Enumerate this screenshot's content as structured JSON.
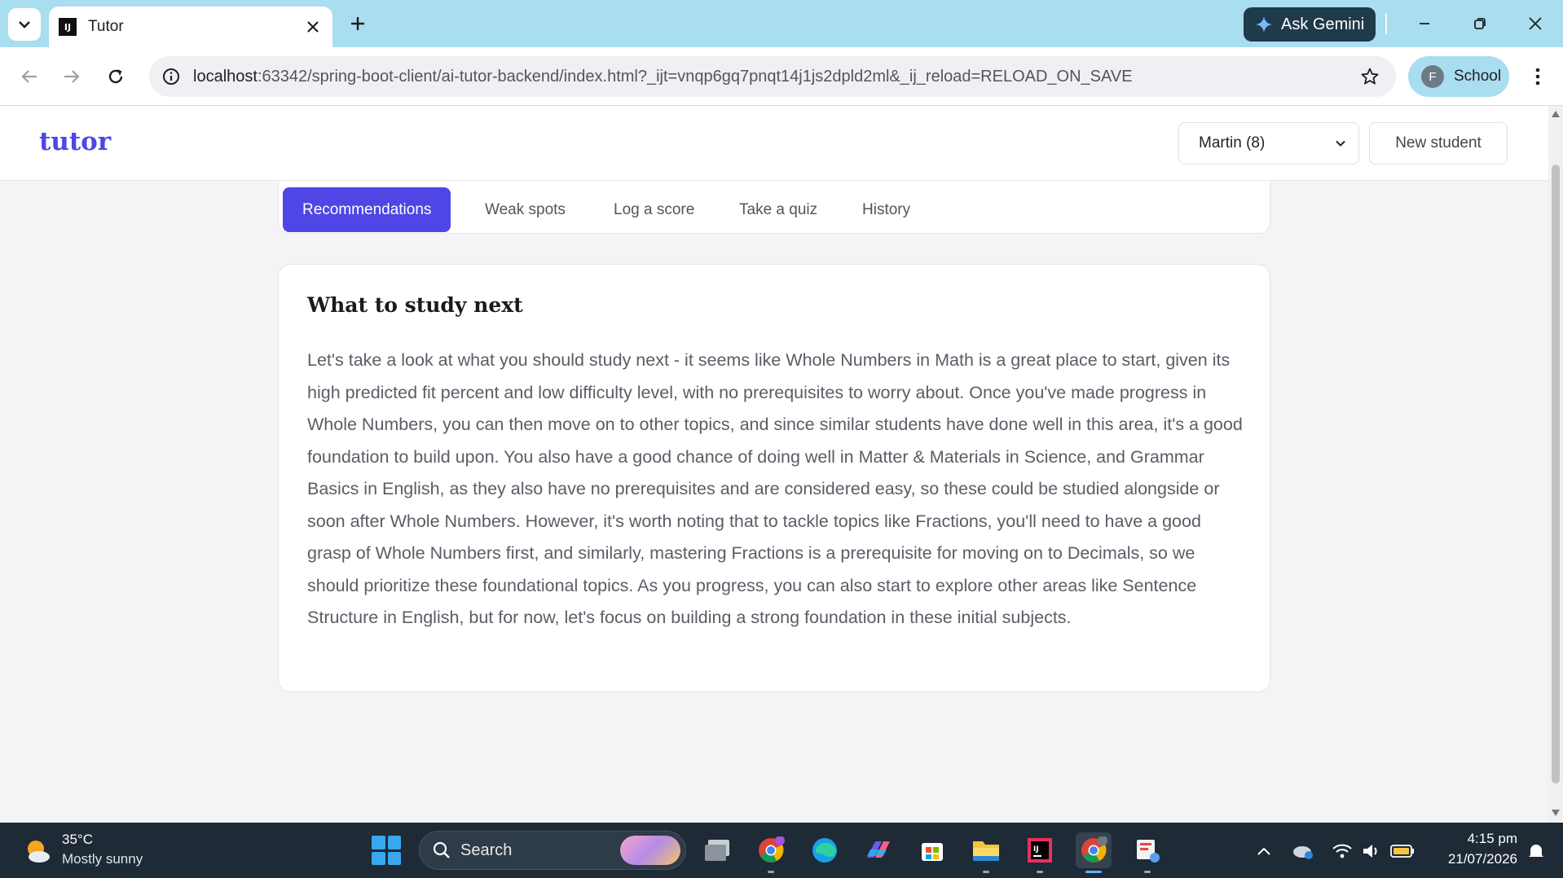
{
  "browser": {
    "tab_title": "Tutor",
    "favicon_text": "IJ",
    "gemini_label": "Ask Gemini",
    "url_host": "localhost",
    "url_rest": ":63342/spring-boot-client/ai-tutor-backend/index.html?_ijt=vnqp6gq7pnqt14j1js2dpld2ml&_ij_reload=RELOAD_ON_SAVE",
    "profile_initial": "F",
    "profile_name": "School"
  },
  "app": {
    "brand": "tutor",
    "student_selected": "Martin (8)",
    "new_student_label": "New student",
    "tabs": [
      {
        "label": "Recommendations",
        "active": true
      },
      {
        "label": "Weak spots",
        "active": false
      },
      {
        "label": "Log a score",
        "active": false
      },
      {
        "label": "Take a quiz",
        "active": false
      },
      {
        "label": "History",
        "active": false
      }
    ],
    "card": {
      "title": "What to study next",
      "body": "Let's take a look at what you should study next - it seems like Whole Numbers in Math is a great place to start, given its high predicted fit percent and low difficulty level, with no prerequisites to worry about. Once you've made progress in Whole Numbers, you can then move on to other topics, and since similar students have done well in this area, it's a good foundation to build upon. You also have a good chance of doing well in Matter & Materials in Science, and Grammar Basics in English, as they also have no prerequisites and are considered easy, so these could be studied alongside or soon after Whole Numbers. However, it's worth noting that to tackle topics like Fractions, you'll need to have a good grasp of Whole Numbers first, and similarly, mastering Fractions is a prerequisite for moving on to Decimals, so we should prioritize these foundational topics. As you progress, you can also start to explore other areas like Sentence Structure in English, but for now, let's focus on building a strong foundation in these initial subjects."
    }
  },
  "colors": {
    "accent": "#4f46e5",
    "tabstrip": "#a9ddf0",
    "taskbar": "#1e2a36"
  },
  "taskbar": {
    "temperature": "35°C",
    "weather": "Mostly sunny",
    "search_label": "Search",
    "time": "4:15 pm",
    "date": "21/07/2026",
    "apps": [
      "file-manager-icon",
      "chrome-icon",
      "edge-icon",
      "m365-icon",
      "store-icon",
      "explorer-icon",
      "intellij-icon",
      "chrome-profile-icon",
      "snipping-tool-icon"
    ]
  }
}
